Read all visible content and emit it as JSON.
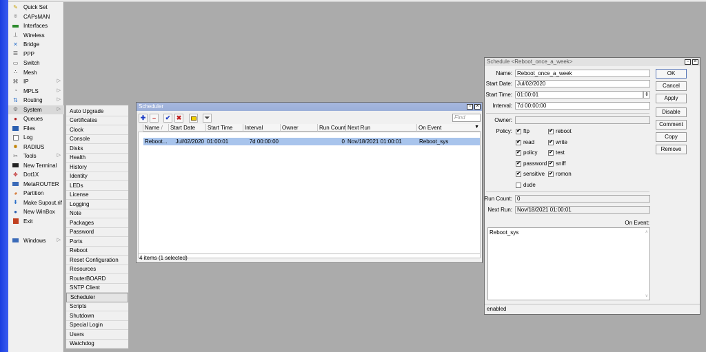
{
  "colors": {
    "accent_blue": "#2744e8",
    "selection": "#a8c4ec",
    "title_active": "#9bafd9"
  },
  "menu": {
    "items": [
      {
        "label": "Quick Set",
        "icon": "wand-icon"
      },
      {
        "label": "CAPsMAN",
        "icon": "capsman-icon"
      },
      {
        "label": "Interfaces",
        "icon": "interfaces-icon"
      },
      {
        "label": "Wireless",
        "icon": "wireless-icon"
      },
      {
        "label": "Bridge",
        "icon": "bridge-icon"
      },
      {
        "label": "PPP",
        "icon": "ppp-icon"
      },
      {
        "label": "Switch",
        "icon": "switch-icon"
      },
      {
        "label": "Mesh",
        "icon": "mesh-icon"
      },
      {
        "label": "IP",
        "icon": "ip-icon",
        "arrow": "▷"
      },
      {
        "label": "MPLS",
        "icon": "mpls-icon",
        "arrow": "▷"
      },
      {
        "label": "Routing",
        "icon": "routing-icon",
        "arrow": "▷"
      },
      {
        "label": "System",
        "icon": "system-icon",
        "arrow": "▷"
      },
      {
        "label": "Queues",
        "icon": "queues-icon"
      },
      {
        "label": "Files",
        "icon": "files-icon"
      },
      {
        "label": "Log",
        "icon": "log-icon"
      },
      {
        "label": "RADIUS",
        "icon": "radius-icon"
      },
      {
        "label": "Tools",
        "icon": "tools-icon",
        "arrow": "▷"
      },
      {
        "label": "New Terminal",
        "icon": "terminal-icon"
      },
      {
        "label": "Dot1X",
        "icon": "dot1x-icon"
      },
      {
        "label": "MetaROUTER",
        "icon": "metarouter-icon"
      },
      {
        "label": "Partition",
        "icon": "partition-icon"
      },
      {
        "label": "Make Supout.rif",
        "icon": "supout-icon"
      },
      {
        "label": "New WinBox",
        "icon": "winbox-icon"
      },
      {
        "label": "Exit",
        "icon": "exit-icon"
      }
    ],
    "windows": {
      "label": "Windows",
      "arrow": "▷"
    }
  },
  "submenu": {
    "items": [
      "Auto Upgrade",
      "Certificates",
      "Clock",
      "Console",
      "Disks",
      "Health",
      "History",
      "Identity",
      "LEDs",
      "License",
      "Logging",
      "Note",
      "Packages",
      "Password",
      "Ports",
      "Reboot",
      "Reset Configuration",
      "Resources",
      "RouterBOARD",
      "SNTP Client",
      "Scheduler",
      "Scripts",
      "Shutdown",
      "Special Login",
      "Users",
      "Watchdog"
    ]
  },
  "scheduler": {
    "title": "Scheduler",
    "find_placeholder": "Find",
    "columns": [
      "Name",
      "Start Date",
      "Start Time",
      "Interval",
      "Owner",
      "Run Count",
      "Next Run",
      "On Event"
    ],
    "sort_mark": "/",
    "row": {
      "name": "Reboot...",
      "start_date": "Jul/02/2020",
      "start_time": "01:00:01",
      "interval": "7d 00:00:00",
      "owner": "",
      "run_count": "0",
      "next_run": "Nov/18/2021 01:00:01",
      "on_event": "Reboot_sys"
    },
    "status": "4 items (1 selected)"
  },
  "schedule_window": {
    "title": "Schedule <Reboot_once_a_week>",
    "labels": {
      "name": "Name:",
      "start_date": "Start Date:",
      "start_time": "Start Time:",
      "interval": "Interval:",
      "owner": "Owner:",
      "policy": "Policy:",
      "run_count": "Run Count:",
      "next_run": "Next Run:",
      "on_event": "On Event:"
    },
    "values": {
      "name": "Reboot_once_a_week",
      "start_date": "Jul/02/2020",
      "start_time": "01:00:01",
      "interval": "7d 00:00:00",
      "owner": "",
      "run_count": "0",
      "next_run": "Nov/18/2021 01:00:01",
      "on_event": "Reboot_sys"
    },
    "policies": [
      {
        "label": "ftp",
        "checked": true
      },
      {
        "label": "reboot",
        "checked": true
      },
      {
        "label": "read",
        "checked": true
      },
      {
        "label": "write",
        "checked": true
      },
      {
        "label": "policy",
        "checked": true
      },
      {
        "label": "test",
        "checked": true
      },
      {
        "label": "password",
        "checked": true
      },
      {
        "label": "sniff",
        "checked": true
      },
      {
        "label": "sensitive",
        "checked": true
      },
      {
        "label": "romon",
        "checked": true
      },
      {
        "label": "dude",
        "checked": false
      }
    ],
    "buttons": {
      "ok": "OK",
      "cancel": "Cancel",
      "apply": "Apply",
      "disable": "Disable",
      "comment": "Comment",
      "copy": "Copy",
      "remove": "Remove"
    },
    "status": "enabled"
  }
}
